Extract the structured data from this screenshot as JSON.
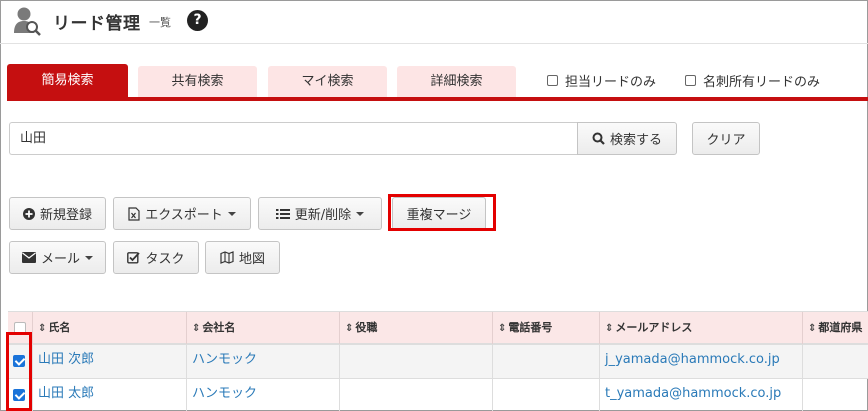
{
  "header": {
    "title": "リード管理",
    "subtitle": "一覧",
    "help": "?"
  },
  "tabs": [
    {
      "label": "簡易検索",
      "active": true
    },
    {
      "label": "共有検索",
      "active": false
    },
    {
      "label": "マイ検索",
      "active": false
    },
    {
      "label": "詳細検索",
      "active": false
    }
  ],
  "filters": [
    {
      "label": "担当リードのみ",
      "checked": false
    },
    {
      "label": "名刺所有リードのみ",
      "checked": false
    }
  ],
  "search": {
    "value": "山田",
    "search_button": "検索する",
    "clear_button": "クリア"
  },
  "toolbar": {
    "new": "新規登録",
    "export": "エクスポート",
    "update_delete": "更新/削除",
    "merge": "重複マージ",
    "mail": "メール",
    "task": "タスク",
    "map": "地図"
  },
  "table": {
    "columns": [
      "氏名",
      "会社名",
      "役職",
      "電話番号",
      "メールアドレス",
      "都道府県"
    ],
    "rows": [
      {
        "name": "山田 次郎",
        "company": "ハンモック",
        "title": "",
        "phone": "",
        "email": "j_yamada@hammock.co.jp",
        "pref": "",
        "checked": true
      },
      {
        "name": "山田 太郎",
        "company": "ハンモック",
        "title": "",
        "phone": "",
        "email": "t_yamada@hammock.co.jp",
        "pref": "",
        "checked": true
      }
    ]
  },
  "colors": {
    "accent": "#c50f10",
    "tab_inactive": "#fde5e5",
    "highlight": "#e30000",
    "link": "#2a7ab8",
    "checkbox": "#1a73d9"
  }
}
